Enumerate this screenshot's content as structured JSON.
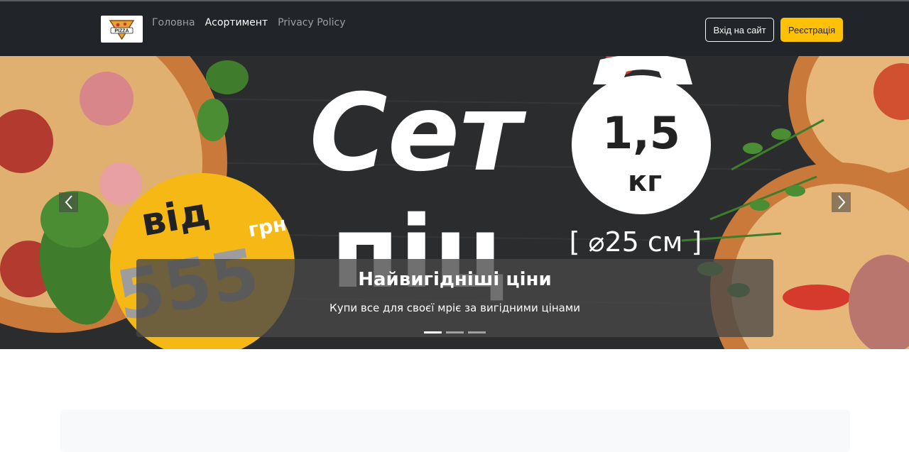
{
  "nav": {
    "logo_text": "PIZZA",
    "links": [
      {
        "label": "Головна",
        "active": false
      },
      {
        "label": "Асортимент",
        "active": true
      },
      {
        "label": "Privacy Policy",
        "active": false
      }
    ],
    "login_label": "Вхід на сайт",
    "register_label": "Реєстрація"
  },
  "carousel": {
    "banner": {
      "headline_top": "Сет",
      "headline_bottom": "піц",
      "weight_value": "1,5",
      "weight_unit": "кг",
      "price_prefix": "від",
      "price_value": "555",
      "price_unit": "грн",
      "size_text": "[ ⌀25 см ]"
    },
    "caption_title": "Найвигідніші ціни",
    "caption_text": "Купи все для своєї мріє за вигідними цінами",
    "slide_count": 3,
    "active_slide": 1,
    "prev_icon": "chevron-left-icon",
    "next_icon": "chevron-right-icon"
  },
  "colors": {
    "navbar_bg": "#212529",
    "accent": "#ffc107",
    "banner_bg": "#2b2c2e"
  }
}
